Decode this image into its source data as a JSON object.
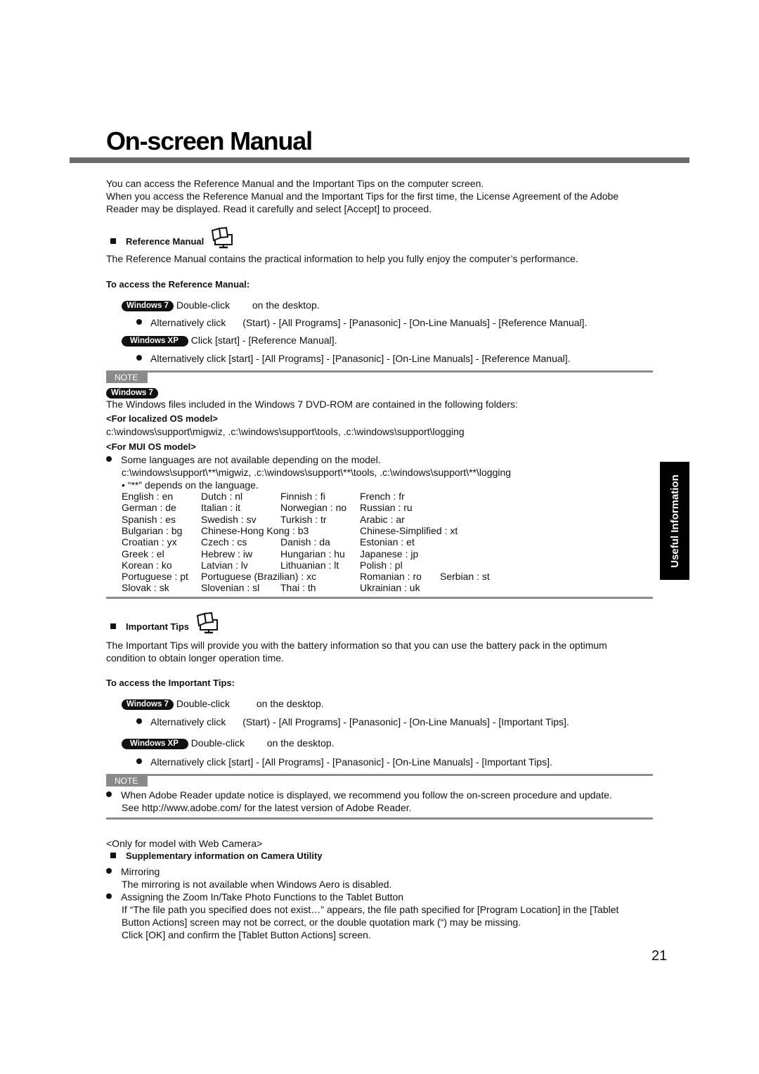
{
  "title": "On-screen Manual",
  "intro": [
    "You can access the Reference Manual and the Important Tips on the computer screen.",
    "When you access the Reference Manual and the Important Tips for the first time, the License Agreement of the Adobe",
    "Reader may be displayed. Read it carefully and select [Accept] to proceed."
  ],
  "reference": {
    "heading": "Reference Manual",
    "description": "The Reference Manual contains the practical information to help you fully enjoy the computer’s performance.",
    "access_heading": "To access the Reference Manual:",
    "win7_badge": "Windows 7",
    "win7_step_a": "Double-click",
    "win7_step_b": "on the desktop.",
    "win7_alt_a": "Alternatively click",
    "win7_alt_b": "(Start) - [All Programs] - [Panasonic] - [On-Line Manuals] - [Reference Manual].",
    "xp_badge": "Windows XP",
    "xp_step": "Click [start] - [Reference Manual].",
    "xp_alt": "Alternatively click [start] - [All Programs] - [Panasonic] - [On-Line Manuals] - [Reference Manual]."
  },
  "note1": {
    "label": "NOTE",
    "badge": "Windows 7",
    "text": "The Windows files included in the Windows 7 DVD-ROM are contained in the following folders:",
    "localized_heading": "<For localized OS model>",
    "localized_paths": "c:\\windows\\support\\migwiz, .c:\\windows\\support\\tools, .c:\\windows\\support\\logging",
    "mui_heading": "<For MUI OS model>",
    "mui_bullet": "Some languages are not available depending on the model.",
    "mui_paths": "c:\\windows\\support\\**\\migwiz, .c:\\windows\\support\\**\\tools, .c:\\windows\\support\\**\\logging",
    "mui_sub": "• “**” depends on the language.",
    "languages": [
      [
        "English : en",
        "Dutch : nl",
        "Finnish : fi",
        "French : fr",
        ""
      ],
      [
        "German : de",
        "Italian : it",
        "Norwegian : no",
        "Russian : ru",
        ""
      ],
      [
        "Spanish : es",
        "Swedish : sv",
        "Turkish : tr",
        "Arabic : ar",
        ""
      ],
      [
        "Bulgarian : bg",
        "Chinese-Hong Kong : b3",
        "",
        "Chinese-Simplified : xt",
        ""
      ],
      [
        "Croatian : yx",
        "Czech : cs",
        "Danish : da",
        "Estonian : et",
        ""
      ],
      [
        "Greek : el",
        "Hebrew : iw",
        "Hungarian : hu",
        "Japanese : jp",
        ""
      ],
      [
        "Korean : ko",
        "Latvian : lv",
        "Lithuanian : lt",
        "Polish : pl",
        ""
      ],
      [
        "Portuguese : pt",
        "Portuguese (Brazilian) : xc",
        "",
        "Romanian : ro",
        "Serbian : st"
      ],
      [
        "Slovak : sk",
        "Slovenian : sl",
        "Thai : th",
        "Ukrainian : uk",
        ""
      ]
    ]
  },
  "tips": {
    "heading": "Important Tips",
    "description_1": "The Important Tips will provide you with the battery information so that you can use the battery pack in the optimum",
    "description_2": "condition to obtain longer operation time.",
    "access_heading": "To access the Important Tips:",
    "win7_badge": "Windows 7",
    "win7_step_a": "Double-click",
    "win7_step_b": "on the desktop.",
    "win7_alt_a": "Alternatively click",
    "win7_alt_b": "(Start) - [All Programs] - [Panasonic] - [On-Line Manuals] - [Important Tips].",
    "xp_badge": "Windows XP",
    "xp_step_a": "Double-click",
    "xp_step_b": "on the desktop.",
    "xp_alt": "Alternatively click [start] - [All Programs] - [Panasonic] - [On-Line Manuals] - [Important Tips]."
  },
  "note2": {
    "label": "NOTE",
    "line1": "When Adobe Reader update notice is displayed, we recommend you follow the on-screen procedure and update.",
    "line2": "See http://www.adobe.com/ for the latest version of Adobe Reader."
  },
  "camera": {
    "qualifier": "<Only for model with Web Camera>",
    "heading": "Supplementary information on Camera Utility",
    "mirroring_title": "Mirroring",
    "mirroring_text": "The mirroring is not available when Windows Aero is disabled.",
    "assign_title": "Assigning the Zoom In/Take Photo Functions to the Tablet Button",
    "assign_text_1": "If “The file path you specified does not exist…” appears, the file path specified for [Program Location] in the [Tablet",
    "assign_text_2": "Button Actions] screen may not be correct, or the double quotation mark (“) may be missing.",
    "assign_text_3": "Click [OK] and confirm the [Tablet Button Actions] screen."
  },
  "side_tab": "Useful Information",
  "page_number": "21"
}
